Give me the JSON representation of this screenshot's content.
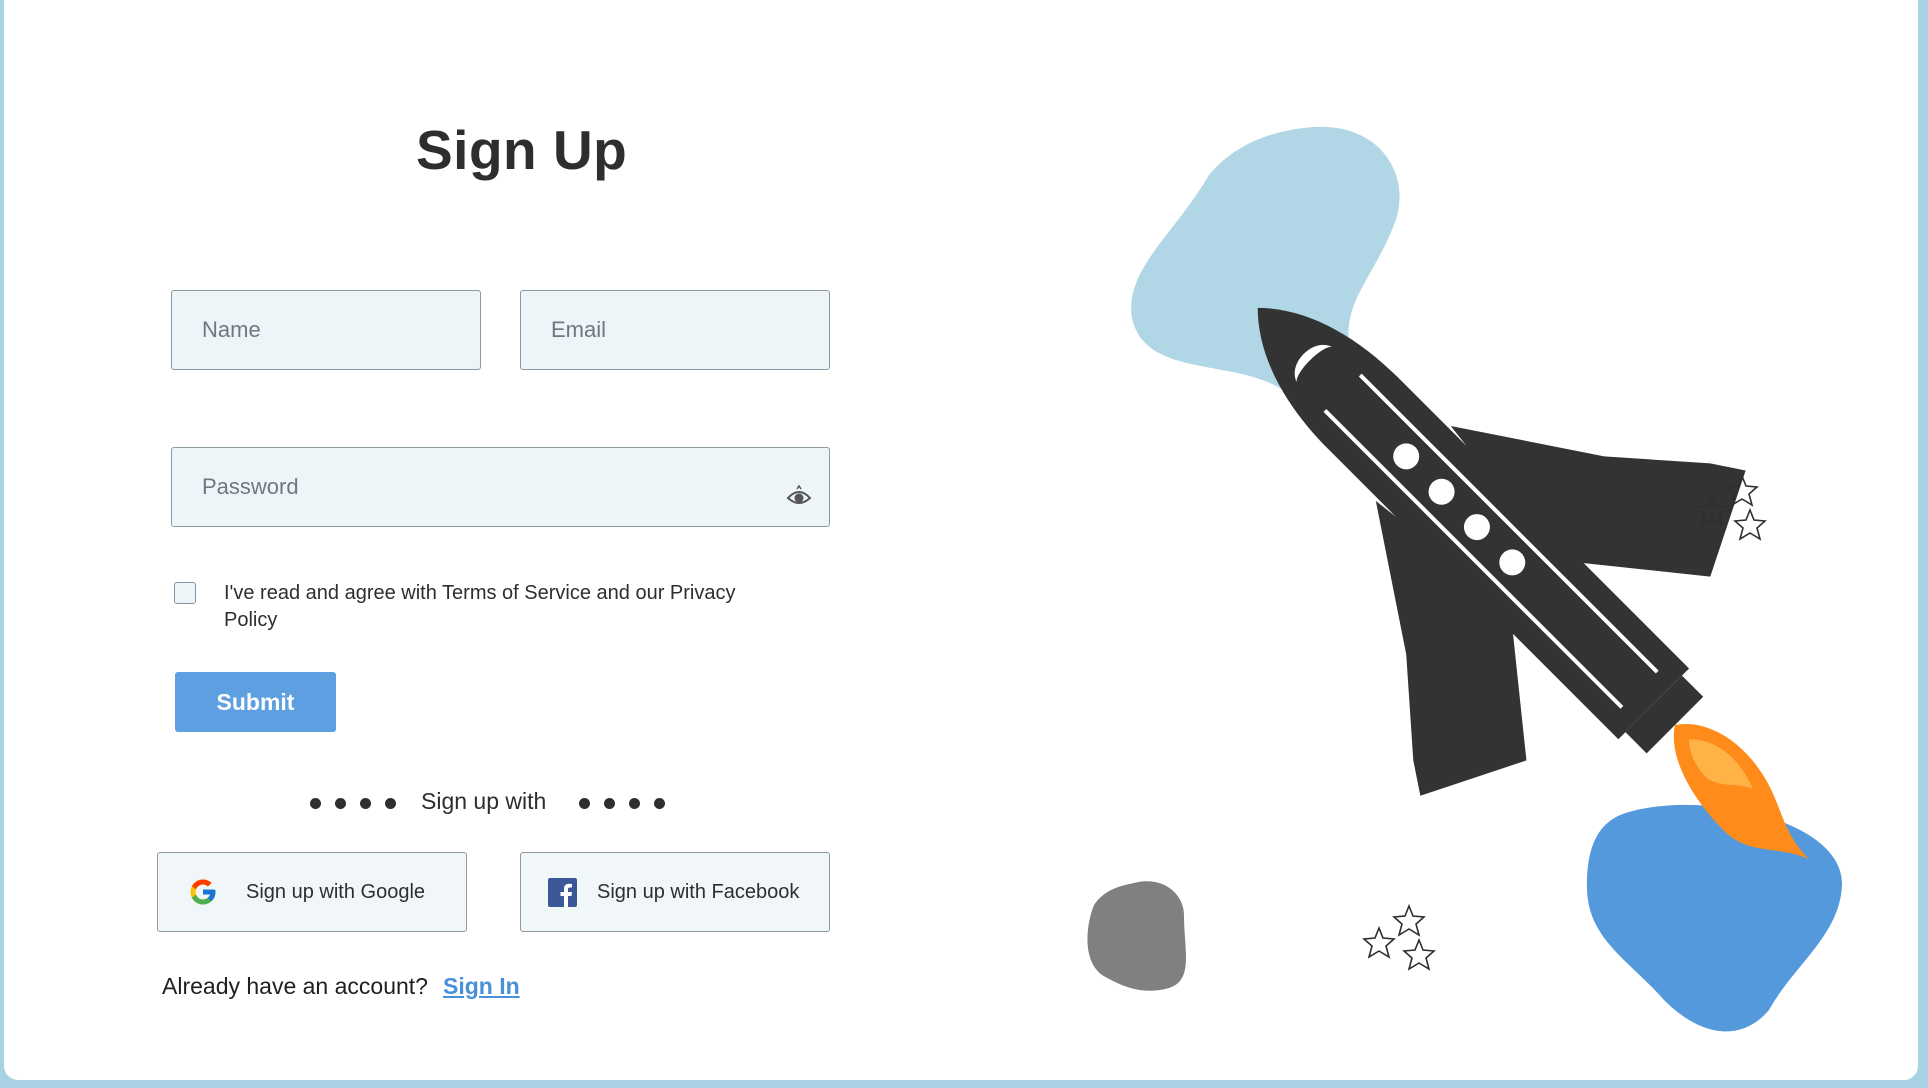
{
  "page": {
    "title": "Sign Up"
  },
  "form": {
    "name_placeholder": "Name",
    "email_placeholder": "Email",
    "password_placeholder": "Password",
    "terms_text": "I've read and agree with Terms of Service and our Privacy Policy",
    "terms_checked": false,
    "submit_label": "Submit"
  },
  "social": {
    "divider_label": "Sign up with",
    "google_label": "Sign up with Google",
    "facebook_label": "Sign up with Facebook"
  },
  "footer": {
    "question": "Already have an account?",
    "signin_label": "Sign In"
  },
  "colors": {
    "accent": "#5d9fe0",
    "link": "#4a90d9",
    "input_bg": "#eef5f8",
    "rocket": "#333333",
    "flame": "#ff8c1a",
    "blob_light": "#b1d6e6",
    "blob_blue": "#5499dc",
    "blob_gray": "#808080"
  },
  "icons": [
    "eye-icon",
    "google-icon",
    "facebook-icon",
    "rocket-illustration",
    "star-icon"
  ]
}
